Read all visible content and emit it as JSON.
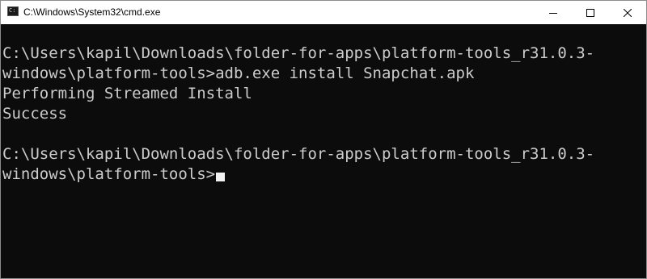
{
  "window": {
    "title": "C:\\Windows\\System32\\cmd.exe",
    "icon": "command-prompt-icon"
  },
  "caption_buttons": {
    "minimize_icon": "minimize-icon",
    "maximize_icon": "maximize-icon",
    "close_icon": "close-icon"
  },
  "console": {
    "lines": [
      "",
      "C:\\Users\\kapil\\Downloads\\folder-for-apps\\platform-tools_r31.0.3-",
      "windows\\platform-tools>adb.exe install Snapchat.apk",
      "Performing Streamed Install",
      "Success",
      "",
      "C:\\Users\\kapil\\Downloads\\folder-for-apps\\platform-tools_r31.0.3-",
      "windows\\platform-tools>"
    ],
    "text_color": "#cccccc",
    "background_color": "#0c0c0c",
    "cursor_color": "#f2f2f2"
  }
}
